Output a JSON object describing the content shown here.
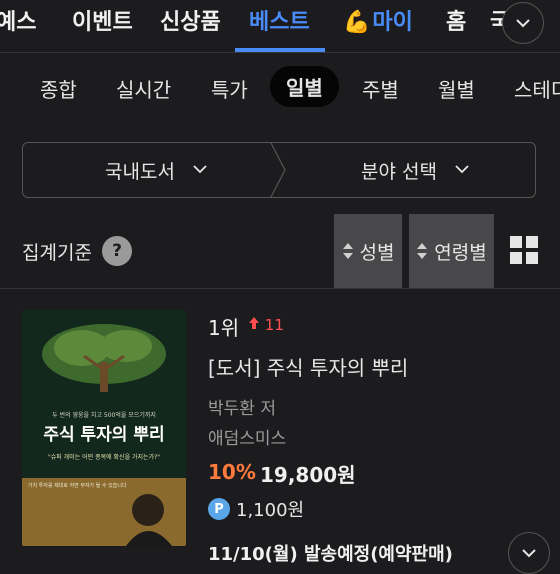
{
  "nav": {
    "items": [
      {
        "label": "예스",
        "active": false
      },
      {
        "label": "이벤트",
        "active": false
      },
      {
        "label": "신상품",
        "active": false
      },
      {
        "label": "베스트",
        "active": true
      },
      {
        "label": "마이",
        "active": false
      },
      {
        "label": "홈",
        "active": false
      },
      {
        "label": "국",
        "active": false
      }
    ],
    "accent": "#4a8cf7",
    "my_emoji": "💪"
  },
  "subtabs": [
    "종합",
    "실시간",
    "특가",
    "일별",
    "주별",
    "월별",
    "스테디"
  ],
  "subtab_active": "일별",
  "selector": {
    "category": "국내도서",
    "field": "분야 선택"
  },
  "filter": {
    "label": "집계기준",
    "help": "?",
    "sort_gender": "성별",
    "sort_age": "연령별"
  },
  "book": {
    "rank": "1위",
    "rank_change": "11",
    "title": "[도서] 주식 투자의 뿌리",
    "author": "박두환 저",
    "publisher": "애덤스미스",
    "discount": "10%",
    "price": "19,800원",
    "points_badge": "P",
    "points": "1,100원",
    "shipping": "11/10(월) 발송예정(예약판매)",
    "cover": {
      "tagline": "두 번의 영웅을 치고 500억을 모으기까지",
      "title": "주식 투자의 뿌리",
      "quote": "\"슈퍼 개미는 어떤 종목에 확신을 가지는가?\"",
      "lines": "가치 투자를 제대로 하면 부자가 될 수 있습니다"
    }
  }
}
